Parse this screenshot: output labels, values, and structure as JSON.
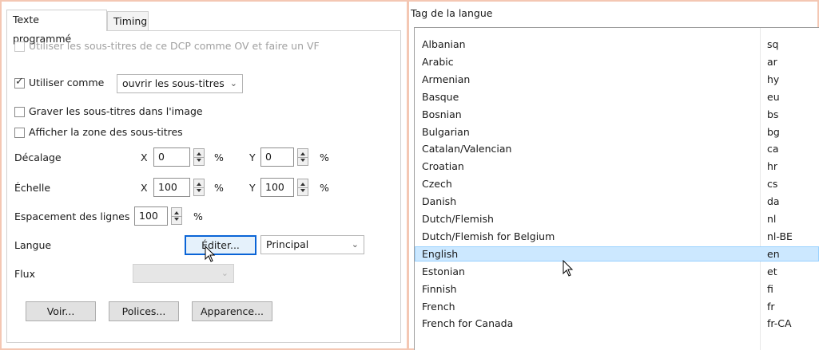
{
  "left": {
    "tabs": [
      "Texte programmé",
      "Timing"
    ],
    "ov_vf_label": "Utiliser les sous-titres de ce DCP comme OV et faire un VF",
    "use_as_label": "Utiliser comme",
    "use_as_value": "ouvrir les sous-titres",
    "burn_label": "Graver les sous-titres dans l'image",
    "show_area_label": "Afficher la zone des sous-titres",
    "offset": {
      "label": "Décalage",
      "x_label": "X",
      "x_value": "0",
      "x_unit": "%",
      "y_label": "Y",
      "y_value": "0",
      "y_unit": "%"
    },
    "scale": {
      "label": "Échelle",
      "x_label": "X",
      "x_value": "100",
      "x_unit": "%",
      "y_label": "Y",
      "y_value": "100",
      "y_unit": "%"
    },
    "line_spacing": {
      "label": "Espacement des lignes",
      "value": "100",
      "unit": "%"
    },
    "language": {
      "label": "Langue",
      "edit_button": "Éditer...",
      "value": "Principal"
    },
    "stream": {
      "label": "Flux",
      "value": ""
    },
    "buttons": {
      "view": "Voir...",
      "fonts": "Polices...",
      "appearance": "Apparence..."
    }
  },
  "right": {
    "title": "Tag de la langue",
    "languages": [
      {
        "name": "Albanian",
        "tag": "sq"
      },
      {
        "name": "Arabic",
        "tag": "ar"
      },
      {
        "name": "Armenian",
        "tag": "hy"
      },
      {
        "name": "Basque",
        "tag": "eu"
      },
      {
        "name": "Bosnian",
        "tag": "bs"
      },
      {
        "name": "Bulgarian",
        "tag": "bg"
      },
      {
        "name": "Catalan/Valencian",
        "tag": "ca"
      },
      {
        "name": "Croatian",
        "tag": "hr"
      },
      {
        "name": "Czech",
        "tag": "cs"
      },
      {
        "name": "Danish",
        "tag": "da"
      },
      {
        "name": "Dutch/Flemish",
        "tag": "nl"
      },
      {
        "name": "Dutch/Flemish for Belgium",
        "tag": "nl-BE"
      },
      {
        "name": "English",
        "tag": "en"
      },
      {
        "name": "Estonian",
        "tag": "et"
      },
      {
        "name": "Finnish",
        "tag": "fi"
      },
      {
        "name": "French",
        "tag": "fr"
      },
      {
        "name": "French for Canada",
        "tag": "fr-CA"
      }
    ],
    "selected": "English"
  },
  "colors": {
    "border_accent": "#f4c7b3",
    "selection_bg": "#cce8ff",
    "focus_blue": "#0a64d6"
  }
}
